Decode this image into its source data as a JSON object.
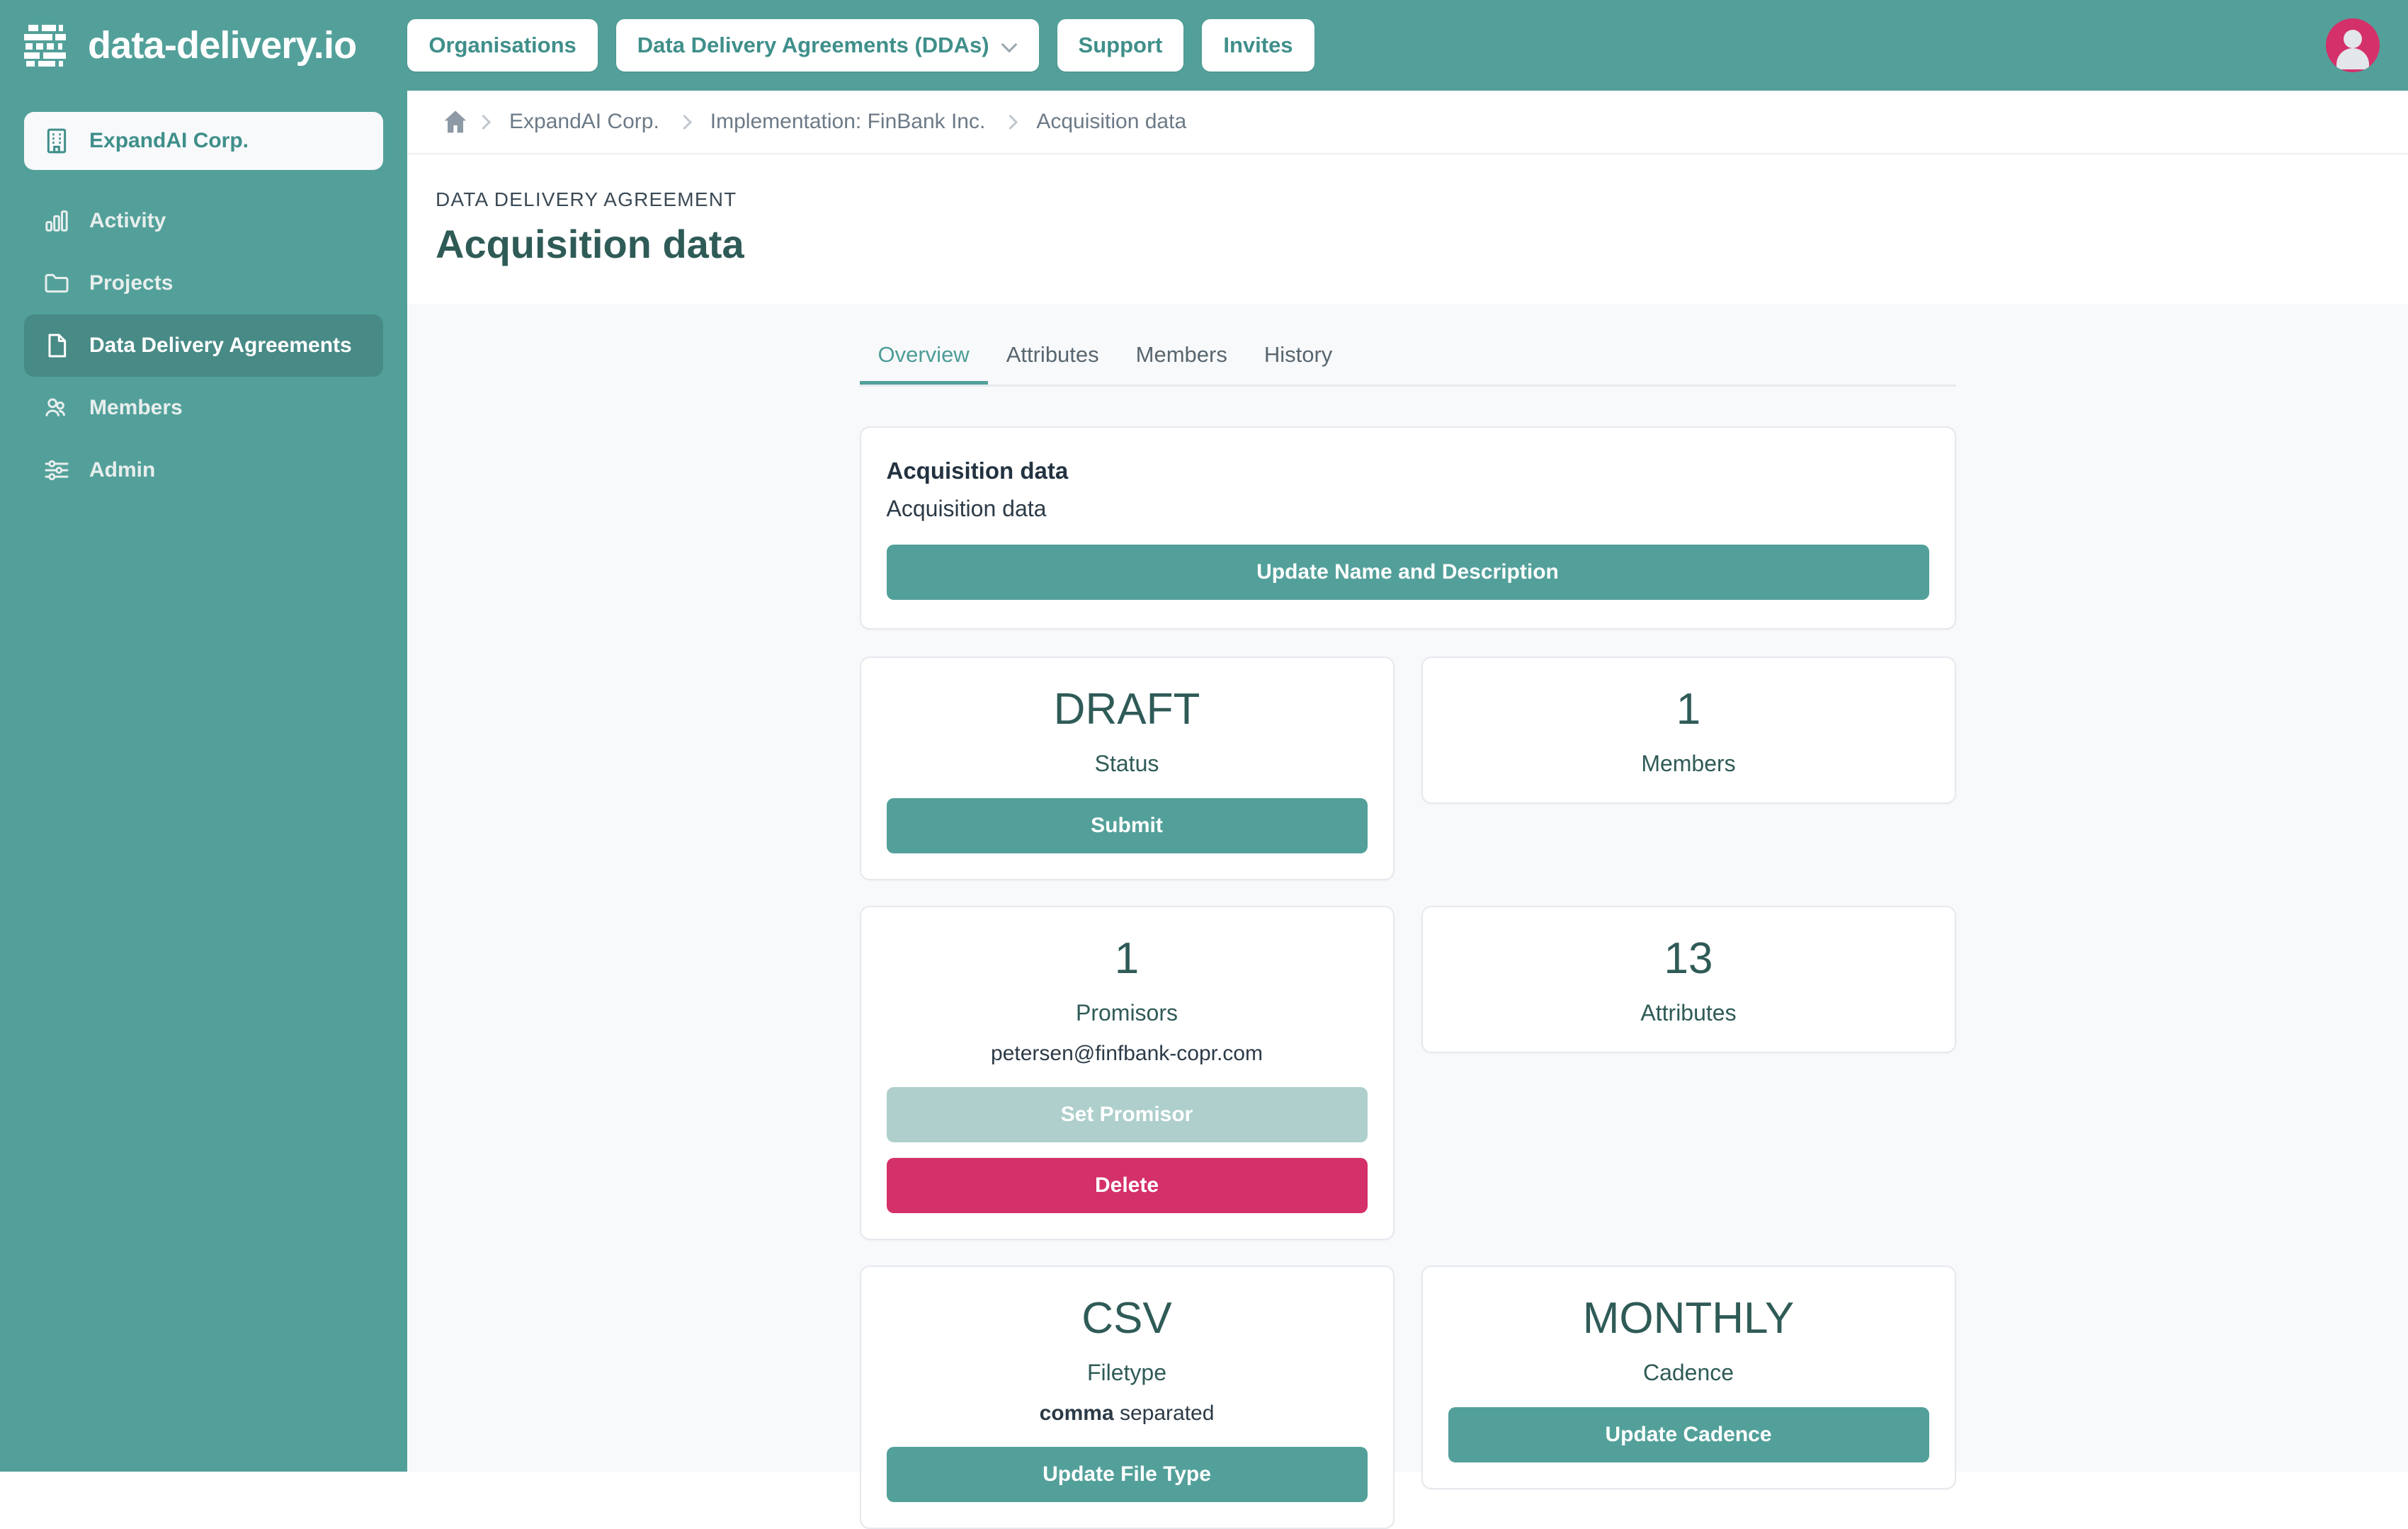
{
  "topbar": {
    "logo_text": "data-delivery.io",
    "logo_icon": "brick-grid-logo-icon",
    "nav": [
      {
        "label": "Organisations",
        "icon": null
      },
      {
        "label": "Data Delivery Agreements (DDAs)",
        "icon": "chevron-down-icon"
      },
      {
        "label": "Support",
        "icon": null
      },
      {
        "label": "Invites",
        "icon": null
      }
    ],
    "avatar_icon": "user-avatar-icon",
    "bg_color": "#53a09a",
    "avatar_color": "#d4306a"
  },
  "sidebar": {
    "org": {
      "label": "ExpandAI Corp.",
      "icon": "building-icon"
    },
    "items": [
      {
        "label": "Activity",
        "icon": "bar-chart-icon",
        "active": false
      },
      {
        "label": "Projects",
        "icon": "folder-icon",
        "active": false
      },
      {
        "label": "Data Delivery Agreements",
        "icon": "document-icon",
        "active": true
      },
      {
        "label": "Members",
        "icon": "users-icon",
        "active": false
      },
      {
        "label": "Admin",
        "icon": "sliders-icon",
        "active": false
      }
    ]
  },
  "breadcrumb": {
    "home_icon": "home-icon",
    "items": [
      "ExpandAI Corp.",
      "Implementation: FinBank Inc.",
      "Acquisition data"
    ]
  },
  "header": {
    "eyebrow": "DATA DELIVERY AGREEMENT",
    "title": "Acquisition data"
  },
  "tabs": [
    {
      "label": "Overview",
      "active": true
    },
    {
      "label": "Attributes",
      "active": false
    },
    {
      "label": "Members",
      "active": false
    },
    {
      "label": "History",
      "active": false
    }
  ],
  "name_card": {
    "name": "Acquisition data",
    "description": "Acquisition data",
    "update_button": "Update Name and Description"
  },
  "cards": {
    "status": {
      "value": "DRAFT",
      "caption": "Status",
      "button": "Submit"
    },
    "members": {
      "value": "1",
      "caption": "Members"
    },
    "promisors": {
      "value": "1",
      "caption": "Promisors",
      "email": "petersen@finfbank-copr.com",
      "set_button": "Set Promisor",
      "delete_button": "Delete"
    },
    "attributes": {
      "value": "13",
      "caption": "Attributes"
    },
    "filetype": {
      "value": "CSV",
      "caption": "Filetype",
      "separator_bold": "comma",
      "separator_rest": " separated",
      "button": "Update File Type"
    },
    "cadence": {
      "value": "MONTHLY",
      "caption": "Cadence",
      "button": "Update Cadence"
    }
  },
  "colors": {
    "brand_teal": "#53a09a",
    "brand_teal_dark": "#478a86",
    "accent_pink": "#d4306a",
    "muted_teal": "#aecfcc",
    "heading": "#2f5b57",
    "page_bg": "#f8f9fb"
  }
}
